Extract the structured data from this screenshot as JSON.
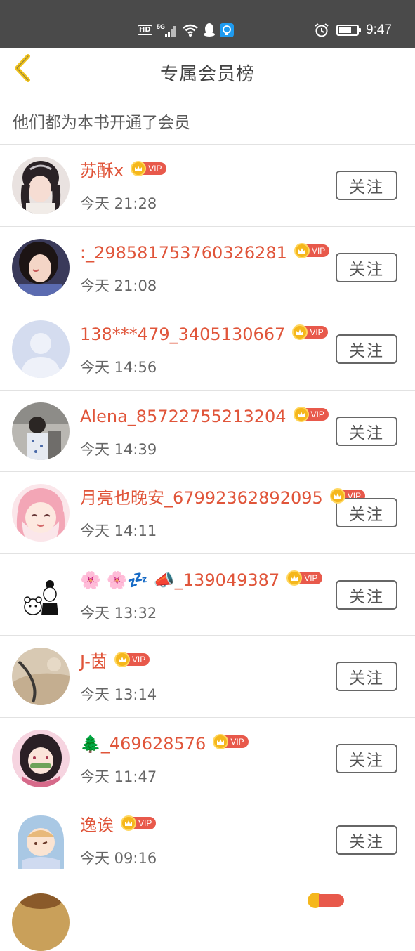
{
  "status_bar": {
    "hd_label": "HD",
    "network_label": "5G",
    "time": "9:47",
    "icons": [
      "signal-icon",
      "wifi-icon",
      "qq-icon",
      "app-notification-icon",
      "alarm-icon",
      "battery-icon"
    ]
  },
  "header": {
    "title": "专属会员榜",
    "back_icon": "chevron-left-icon",
    "accent_color": "#f0c21a"
  },
  "subtitle": "他们都为本书开通了会员",
  "vip_label": "VIP",
  "follow_label": "关注",
  "name_color": "#e0553a",
  "members": [
    {
      "name": "苏酥x",
      "time": "今天 21:28",
      "avatar": "avatar-girl-black-hair"
    },
    {
      "name": ":_298581753760326281",
      "time": "今天 21:08",
      "avatar": "avatar-girl-selfie"
    },
    {
      "name": "138***479_3405130667",
      "time": "今天 14:56",
      "avatar": "avatar-default-silhouette"
    },
    {
      "name": "Alena_85722755213204",
      "time": "今天 14:39",
      "avatar": "avatar-photo-group"
    },
    {
      "name": "月亮也晚安_67992362892095",
      "time": "今天 14:11",
      "avatar": "avatar-anime-pink-hair"
    },
    {
      "name": "🌸 🌸💤 📣_139049387",
      "time": "今天 13:32",
      "avatar": "avatar-sketch-bear"
    },
    {
      "name": "J-茵",
      "time": "今天 13:14",
      "avatar": "avatar-photo-beige"
    },
    {
      "name": "🌲_469628576",
      "time": "今天 11:47",
      "avatar": "avatar-anime-girl-bamboo"
    },
    {
      "name": "逸诶",
      "time": "今天 09:16",
      "avatar": "avatar-anime-shark-hood"
    }
  ]
}
